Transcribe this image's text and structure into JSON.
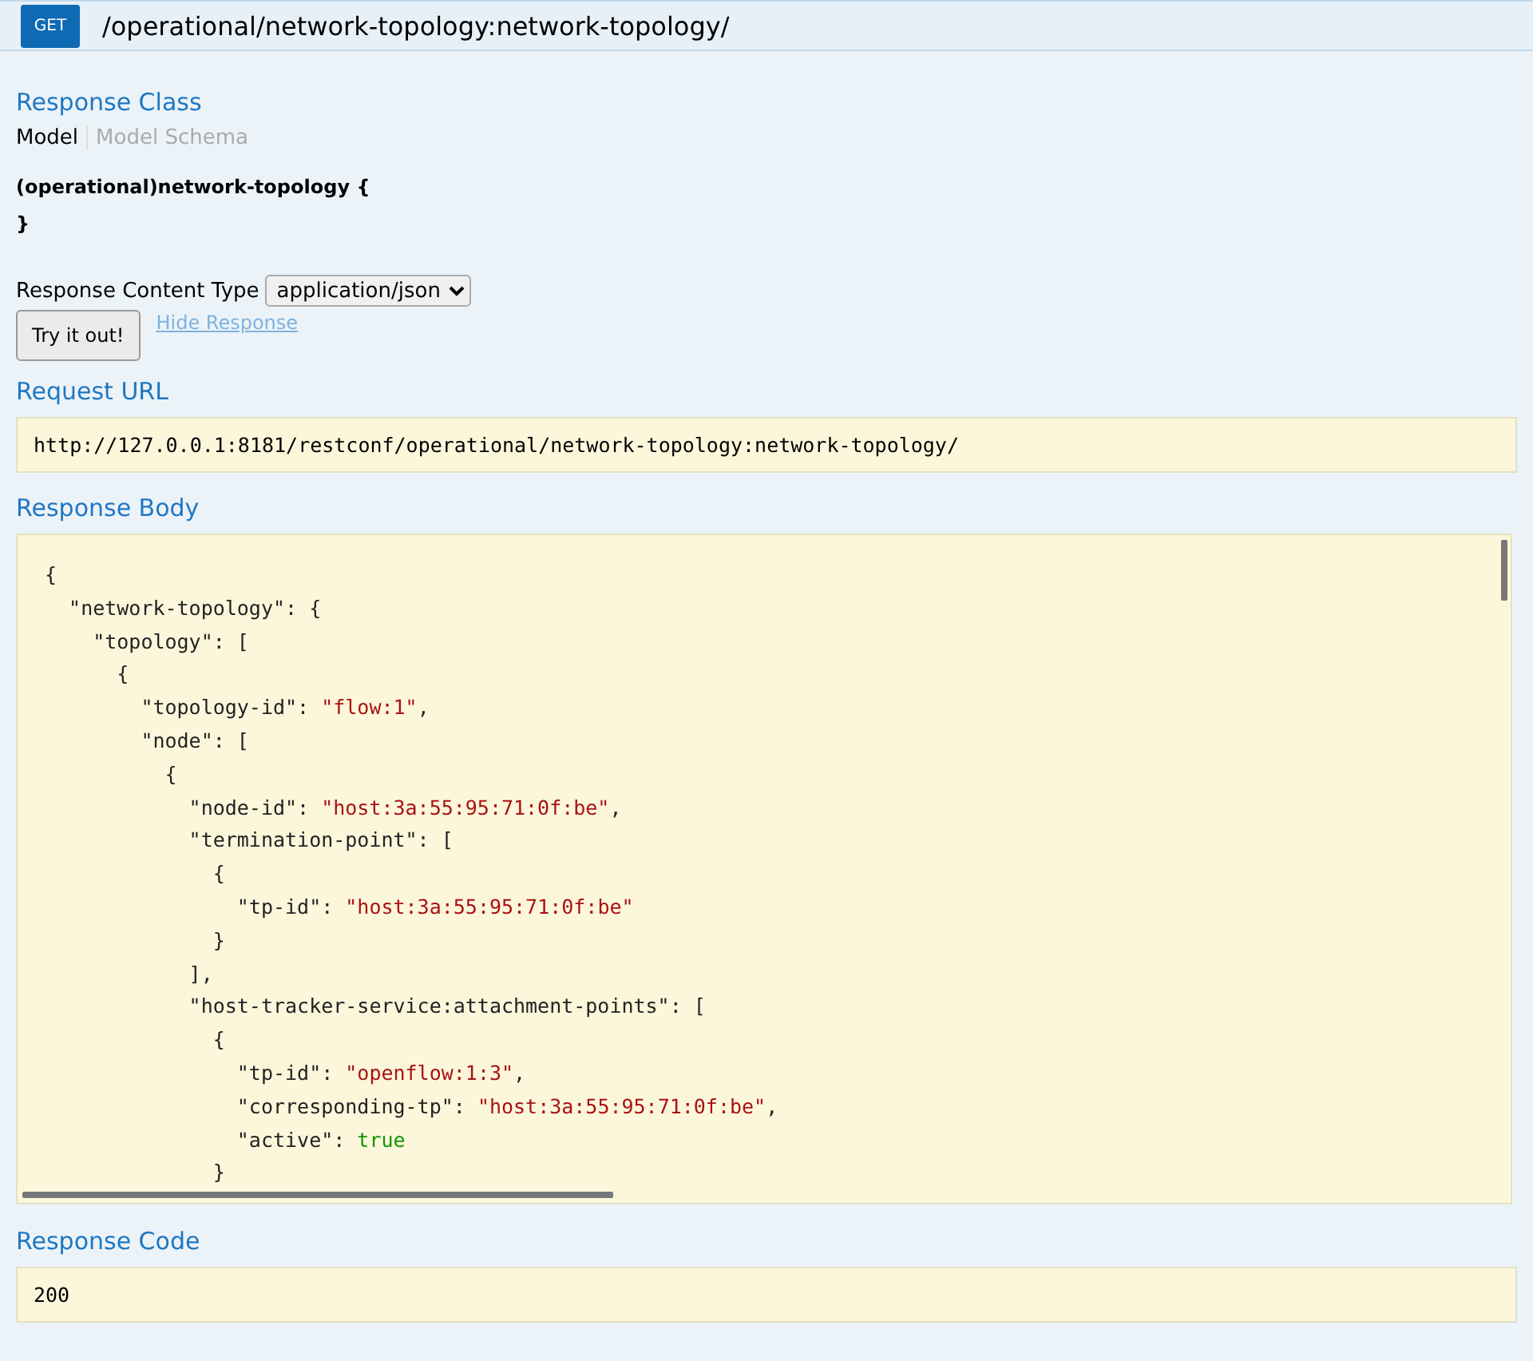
{
  "endpoint": {
    "method": "GET",
    "path": "/operational/network-topology:network-topology/"
  },
  "response_class": {
    "heading": "Response Class",
    "tabs": [
      {
        "label": "Model",
        "selected": true
      },
      {
        "label": "Model Schema",
        "selected": false
      }
    ],
    "model_lines": [
      "(operational)network-topology {",
      "}"
    ]
  },
  "content_type": {
    "label": "Response Content Type",
    "value": "application/json"
  },
  "try_button": "Try it out!",
  "hide_link": "Hide Response",
  "request_url": {
    "heading": "Request URL",
    "value": "http://127.0.0.1:8181/restconf/operational/network-topology:network-topology/"
  },
  "response_body": {
    "heading": "Response Body",
    "lines": [
      [
        {
          "kind": "punct",
          "text": "{"
        }
      ],
      [
        {
          "kind": "punct",
          "text": "  \"network-topology\": {"
        }
      ],
      [
        {
          "kind": "punct",
          "text": "    \"topology\": ["
        }
      ],
      [
        {
          "kind": "punct",
          "text": "      {"
        }
      ],
      [
        {
          "kind": "punct",
          "text": "        \"topology-id\": "
        },
        {
          "kind": "string",
          "text": "\"flow:1\""
        },
        {
          "kind": "punct",
          "text": ","
        }
      ],
      [
        {
          "kind": "punct",
          "text": "        \"node\": ["
        }
      ],
      [
        {
          "kind": "punct",
          "text": "          {"
        }
      ],
      [
        {
          "kind": "punct",
          "text": "            \"node-id\": "
        },
        {
          "kind": "string",
          "text": "\"host:3a:55:95:71:0f:be\""
        },
        {
          "kind": "punct",
          "text": ","
        }
      ],
      [
        {
          "kind": "punct",
          "text": "            \"termination-point\": ["
        }
      ],
      [
        {
          "kind": "punct",
          "text": "              {"
        }
      ],
      [
        {
          "kind": "punct",
          "text": "                \"tp-id\": "
        },
        {
          "kind": "string",
          "text": "\"host:3a:55:95:71:0f:be\""
        }
      ],
      [
        {
          "kind": "punct",
          "text": "              }"
        }
      ],
      [
        {
          "kind": "punct",
          "text": "            ],"
        }
      ],
      [
        {
          "kind": "punct",
          "text": "            \"host-tracker-service:attachment-points\": ["
        }
      ],
      [
        {
          "kind": "punct",
          "text": "              {"
        }
      ],
      [
        {
          "kind": "punct",
          "text": "                \"tp-id\": "
        },
        {
          "kind": "string",
          "text": "\"openflow:1:3\""
        },
        {
          "kind": "punct",
          "text": ","
        }
      ],
      [
        {
          "kind": "punct",
          "text": "                \"corresponding-tp\": "
        },
        {
          "kind": "string",
          "text": "\"host:3a:55:95:71:0f:be\""
        },
        {
          "kind": "punct",
          "text": ","
        }
      ],
      [
        {
          "kind": "punct",
          "text": "                \"active\": "
        },
        {
          "kind": "literal",
          "text": "true"
        }
      ],
      [
        {
          "kind": "punct",
          "text": "              }"
        }
      ]
    ]
  },
  "response_code": {
    "heading": "Response Code",
    "value": "200"
  }
}
